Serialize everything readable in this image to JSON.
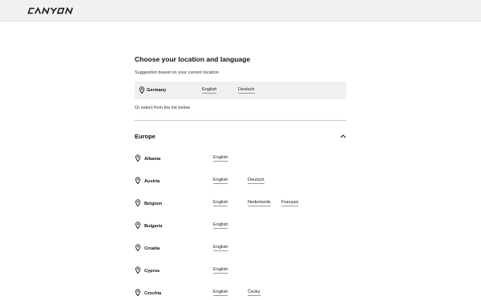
{
  "brand": {
    "logo_text": "CANYON"
  },
  "heading": {
    "title": "Choose your location and language",
    "suggestion_text": "Suggestion based on your current location"
  },
  "suggestion": {
    "country": "Germany",
    "languages": [
      "English",
      "Deutsch"
    ]
  },
  "or_select_text": "Or select from the list below",
  "region": {
    "name": "Europe",
    "expanded": true,
    "countries": [
      {
        "name": "Albania",
        "languages": [
          "English"
        ]
      },
      {
        "name": "Austria",
        "languages": [
          "English",
          "Deutsch"
        ]
      },
      {
        "name": "Belgium",
        "languages": [
          "English",
          "Nederlands",
          "Français"
        ]
      },
      {
        "name": "Bulgaria",
        "languages": [
          "English"
        ]
      },
      {
        "name": "Croatia",
        "languages": [
          "English"
        ]
      },
      {
        "name": "Cyprus",
        "languages": [
          "English"
        ]
      },
      {
        "name": "Czechia",
        "languages": [
          "English",
          "Česky"
        ]
      }
    ]
  }
}
